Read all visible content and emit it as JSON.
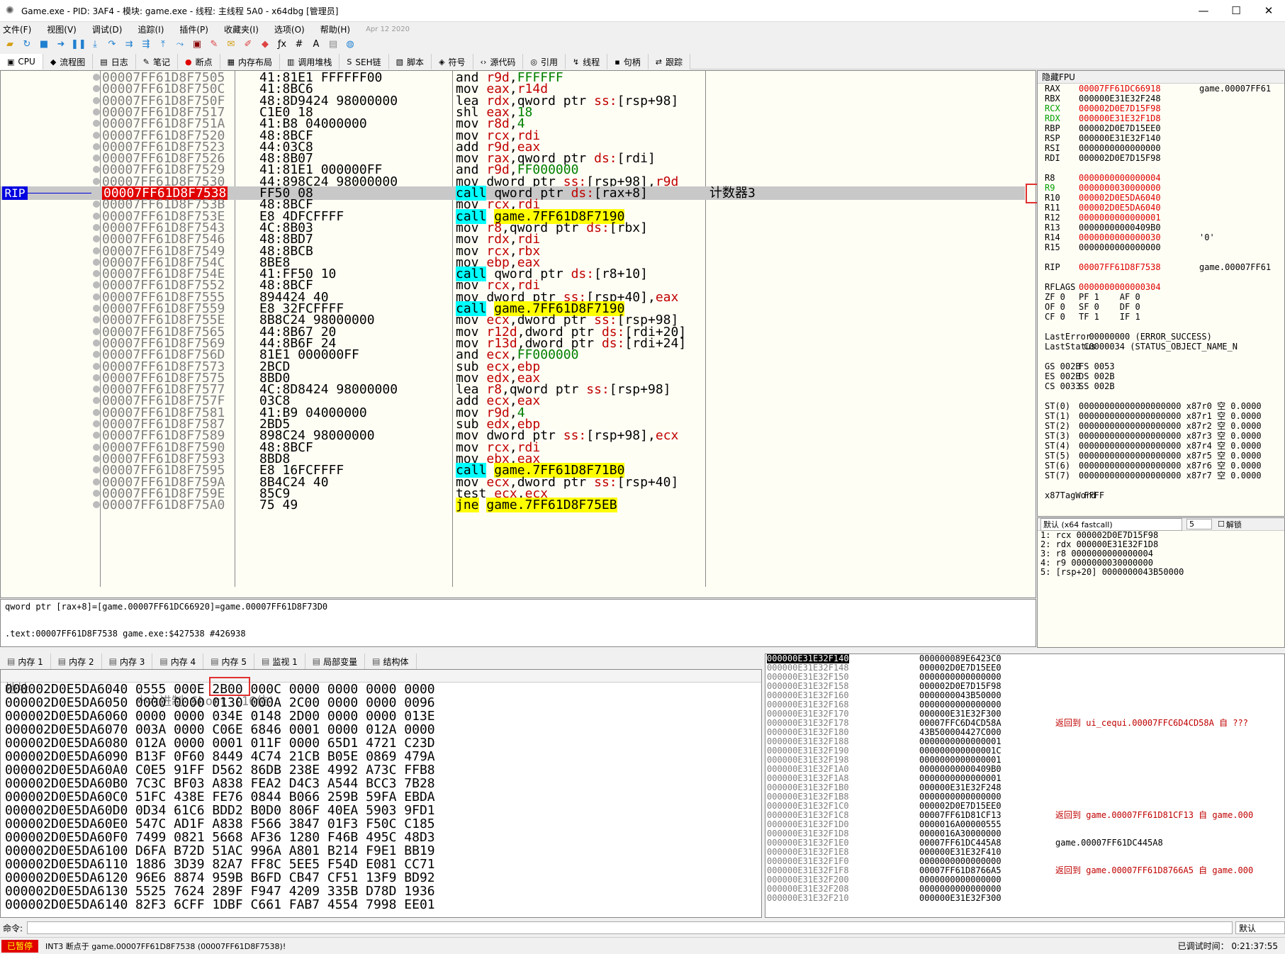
{
  "title": "Game.exe - PID: 3AF4 - 模块: game.exe - 线程: 主线程 5A0 - x64dbg [管理员]",
  "menu": [
    "文件(F)",
    "视图(V)",
    "调试(D)",
    "追踪(I)",
    "插件(P)",
    "收藏夹(I)",
    "选项(O)",
    "帮助(H)",
    "Apr 12 2020"
  ],
  "tabs": [
    "CPU",
    "流程图",
    "日志",
    "笔记",
    "断点",
    "内存布局",
    "调用堆栈",
    "SEH链",
    "脚本",
    "符号",
    "源代码",
    "引用",
    "线程",
    "句柄",
    "跟踪"
  ],
  "rip_label": "RIP",
  "cpu_rows": [
    {
      "addr": "00007FF61D8F7505",
      "bytes": "41:81E1 FFFFFF00",
      "dis": "and r9d,FFFFFF"
    },
    {
      "addr": "00007FF61D8F750C",
      "bytes": "41:8BC6",
      "dis": "mov eax,r14d"
    },
    {
      "addr": "00007FF61D8F750F",
      "bytes": "48:8D9424 98000000",
      "dis": "lea rdx,qword ptr ss:[rsp+98]"
    },
    {
      "addr": "00007FF61D8F7517",
      "bytes": "C1E0 18",
      "dis": "shl eax,18"
    },
    {
      "addr": "00007FF61D8F751A",
      "bytes": "41:B8 04000000",
      "dis": "mov r8d,4"
    },
    {
      "addr": "00007FF61D8F7520",
      "bytes": "48:8BCF",
      "dis": "mov rcx,rdi"
    },
    {
      "addr": "00007FF61D8F7523",
      "bytes": "44:03C8",
      "dis": "add r9d,eax"
    },
    {
      "addr": "00007FF61D8F7526",
      "bytes": "48:8B07",
      "dis": "mov rax,qword ptr ds:[rdi]"
    },
    {
      "addr": "00007FF61D8F7529",
      "bytes": "41:81E1 000000FF",
      "dis": "and r9d,FF000000"
    },
    {
      "addr": "00007FF61D8F7530",
      "bytes": "44:898C24 98000000",
      "dis": "mov dword ptr ss:[rsp+98],r9d"
    },
    {
      "addr": "00007FF61D8F7538",
      "bytes": "FF50 08",
      "dis": "call qword ptr ds:[rax+8]",
      "cmt": "计数器3",
      "cur": true
    },
    {
      "addr": "00007FF61D8F753B",
      "bytes": "48:8BCF",
      "dis": "mov rcx,rdi"
    },
    {
      "addr": "00007FF61D8F753E",
      "bytes": "E8 4DFCFFFF",
      "dis": "call game.7FF61D8F7190"
    },
    {
      "addr": "00007FF61D8F7543",
      "bytes": "4C:8B03",
      "dis": "mov r8,qword ptr ds:[rbx]"
    },
    {
      "addr": "00007FF61D8F7546",
      "bytes": "48:8BD7",
      "dis": "mov rdx,rdi"
    },
    {
      "addr": "00007FF61D8F7549",
      "bytes": "48:8BCB",
      "dis": "mov rcx,rbx"
    },
    {
      "addr": "00007FF61D8F754C",
      "bytes": "8BE8",
      "dis": "mov ebp,eax"
    },
    {
      "addr": "00007FF61D8F754E",
      "bytes": "41:FF50 10",
      "dis": "call qword ptr ds:[r8+10]"
    },
    {
      "addr": "00007FF61D8F7552",
      "bytes": "48:8BCF",
      "dis": "mov rcx,rdi"
    },
    {
      "addr": "00007FF61D8F7555",
      "bytes": "894424 40",
      "dis": "mov dword ptr ss:[rsp+40],eax"
    },
    {
      "addr": "00007FF61D8F7559",
      "bytes": "E8 32FCFFFF",
      "dis": "call game.7FF61D8F7190"
    },
    {
      "addr": "00007FF61D8F755E",
      "bytes": "8B8C24 98000000",
      "dis": "mov ecx,dword ptr ss:[rsp+98]"
    },
    {
      "addr": "00007FF61D8F7565",
      "bytes": "44:8B67 20",
      "dis": "mov r12d,dword ptr ds:[rdi+20]"
    },
    {
      "addr": "00007FF61D8F7569",
      "bytes": "44:8B6F 24",
      "dis": "mov r13d,dword ptr ds:[rdi+24]"
    },
    {
      "addr": "00007FF61D8F756D",
      "bytes": "81E1 000000FF",
      "dis": "and ecx,FF000000"
    },
    {
      "addr": "00007FF61D8F7573",
      "bytes": "2BCD",
      "dis": "sub ecx,ebp"
    },
    {
      "addr": "00007FF61D8F7575",
      "bytes": "8BD0",
      "dis": "mov edx,eax"
    },
    {
      "addr": "00007FF61D8F7577",
      "bytes": "4C:8D8424 98000000",
      "dis": "lea r8,qword ptr ss:[rsp+98]"
    },
    {
      "addr": "00007FF61D8F757F",
      "bytes": "03C8",
      "dis": "add ecx,eax"
    },
    {
      "addr": "00007FF61D8F7581",
      "bytes": "41:B9 04000000",
      "dis": "mov r9d,4"
    },
    {
      "addr": "00007FF61D8F7587",
      "bytes": "2BD5",
      "dis": "sub edx,ebp"
    },
    {
      "addr": "00007FF61D8F7589",
      "bytes": "898C24 98000000",
      "dis": "mov dword ptr ss:[rsp+98],ecx"
    },
    {
      "addr": "00007FF61D8F7590",
      "bytes": "48:8BCF",
      "dis": "mov rcx,rdi"
    },
    {
      "addr": "00007FF61D8F7593",
      "bytes": "8BD8",
      "dis": "mov ebx,eax"
    },
    {
      "addr": "00007FF61D8F7595",
      "bytes": "E8 16FCFFFF",
      "dis": "call game.7FF61D8F71B0"
    },
    {
      "addr": "00007FF61D8F759A",
      "bytes": "8B4C24 40",
      "dis": "mov ecx,dword ptr ss:[rsp+40]"
    },
    {
      "addr": "00007FF61D8F759E",
      "bytes": "85C9",
      "dis": "test ecx,ecx"
    },
    {
      "addr": "00007FF61D8F75A0",
      "bytes": "75 49",
      "dis": "jne game.7FF61D8F75EB"
    }
  ],
  "reg_header": "隐藏FPU",
  "registers": [
    {
      "n": "RAX",
      "v": "00007FF61DC66918",
      "c": "game.00007FF61",
      "col": "red"
    },
    {
      "n": "RBX",
      "v": "000000E31E32F248",
      "c": ""
    },
    {
      "n": "RCX",
      "v": "000002D0E7D15F98",
      "c": "",
      "col": "red",
      "ncol": "green"
    },
    {
      "n": "RDX",
      "v": "000000E31E32F1D8",
      "c": "",
      "col": "red",
      "ncol": "green"
    },
    {
      "n": "RBP",
      "v": "000002D0E7D15EE0",
      "c": ""
    },
    {
      "n": "RSP",
      "v": "000000E31E32F140",
      "c": ""
    },
    {
      "n": "RSI",
      "v": "0000000000000000",
      "c": ""
    },
    {
      "n": "RDI",
      "v": "000002D0E7D15F98",
      "c": ""
    },
    {
      "n": "",
      "v": "",
      "c": ""
    },
    {
      "n": "R8",
      "v": "0000000000000004",
      "c": "",
      "col": "red"
    },
    {
      "n": "R9",
      "v": "0000000030000000",
      "c": "",
      "col": "red",
      "ncol": "green"
    },
    {
      "n": "R10",
      "v": "000002D0E5DA6040",
      "c": "",
      "col": "red"
    },
    {
      "n": "R11",
      "v": "000002D0E5DA6040",
      "c": "",
      "col": "red"
    },
    {
      "n": "R12",
      "v": "0000000000000001",
      "c": "",
      "col": "red"
    },
    {
      "n": "R13",
      "v": "00000000000409B0",
      "c": ""
    },
    {
      "n": "R14",
      "v": "0000000000000030",
      "c": "'0'",
      "col": "red"
    },
    {
      "n": "R15",
      "v": "0000000000000000",
      "c": ""
    },
    {
      "n": "",
      "v": "",
      "c": ""
    },
    {
      "n": "RIP",
      "v": "00007FF61D8F7538",
      "c": "game.00007FF61",
      "col": "red"
    },
    {
      "n": "",
      "v": "",
      "c": ""
    },
    {
      "n": "RFLAGS",
      "v": "0000000000000304",
      "c": "",
      "col": "red"
    },
    {
      "n": "ZF 0",
      "v": "PF 1    AF 0",
      "c": ""
    },
    {
      "n": "OF 0",
      "v": "SF 0    DF 0",
      "c": ""
    },
    {
      "n": "CF 0",
      "v": "TF 1    IF 1",
      "c": ""
    },
    {
      "n": "",
      "v": "",
      "c": ""
    },
    {
      "n": "LastError",
      "v": "  00000000 (ERROR_SUCCESS)",
      "c": ""
    },
    {
      "n": "LastStatus",
      "v": " C0000034 (STATUS_OBJECT_NAME_N",
      "c": ""
    },
    {
      "n": "",
      "v": "",
      "c": ""
    },
    {
      "n": "GS 002B",
      "v": "FS 0053",
      "c": ""
    },
    {
      "n": "ES 002B",
      "v": "DS 002B",
      "c": ""
    },
    {
      "n": "CS 0033",
      "v": "SS 002B",
      "c": ""
    },
    {
      "n": "",
      "v": "",
      "c": ""
    },
    {
      "n": "ST(0)",
      "v": "00000000000000000000 x87r0 空 0.0000",
      "c": ""
    },
    {
      "n": "ST(1)",
      "v": "00000000000000000000 x87r1 空 0.0000",
      "c": ""
    },
    {
      "n": "ST(2)",
      "v": "00000000000000000000 x87r2 空 0.0000",
      "c": ""
    },
    {
      "n": "ST(3)",
      "v": "00000000000000000000 x87r3 空 0.0000",
      "c": ""
    },
    {
      "n": "ST(4)",
      "v": "00000000000000000000 x87r4 空 0.0000",
      "c": ""
    },
    {
      "n": "ST(5)",
      "v": "00000000000000000000 x87r5 空 0.0000",
      "c": ""
    },
    {
      "n": "ST(6)",
      "v": "00000000000000000000 x87r6 空 0.0000",
      "c": ""
    },
    {
      "n": "ST(7)",
      "v": "00000000000000000000 x87r7 空 0.0000",
      "c": ""
    },
    {
      "n": "",
      "v": "",
      "c": ""
    },
    {
      "n": "x87TagWord",
      "v": " FFFF",
      "c": ""
    }
  ],
  "callconv": {
    "label": "默认 (x64 fastcall)",
    "count": "5",
    "unlock": "解锁",
    "args": [
      "1: rcx 000002D0E7D15F98",
      "2: rdx 000000E31E32F1D8",
      "3: r8 0000000000000004",
      "4: r9 0000000030000000",
      "5: [rsp+20] 0000000043B50000"
    ]
  },
  "info": {
    "line1": "qword ptr [rax+8]=[game.00007FF61DC66920]=game.00007FF61D8F73D0",
    "line2": ".text:00007FF61D8F7538 game.exe:$427538 #426938"
  },
  "dump_tabs": [
    "内存 1",
    "内存 2",
    "内存 3",
    "内存 4",
    "内存 5",
    "监视 1",
    "局部变量",
    "结构体"
  ],
  "dump_header": {
    "addr": "地址",
    "hex": "十六进制 Short (16位)"
  },
  "dump_rows": [
    {
      "a": "000002D0E5DA6040",
      "v": "0555 000E 2B00 000C 0000 0000 0000 0000"
    },
    {
      "a": "000002D0E5DA6050",
      "v": "0000 0000 0130 000A 2C00 0000 0000 0096"
    },
    {
      "a": "000002D0E5DA6060",
      "v": "0000 0000 034E 0148 2D00 0000 0000 013E"
    },
    {
      "a": "000002D0E5DA6070",
      "v": "003A 0000 C06E 6846 0001 0000 012A 0000"
    },
    {
      "a": "000002D0E5DA6080",
      "v": "012A 0000 0001 011F 0000 65D1 4721 C23D"
    },
    {
      "a": "000002D0E5DA6090",
      "v": "B13F 0F60 8449 4C74 21CB B05E 0869 479A"
    },
    {
      "a": "000002D0E5DA60A0",
      "v": "C0E5 91FF D562 86DB 238E 4992 A73C FFB8"
    },
    {
      "a": "000002D0E5DA60B0",
      "v": "7C3C BF03 A838 FEA2 D4C3 A544 BCC3 7B28"
    },
    {
      "a": "000002D0E5DA60C0",
      "v": "51FC 438E FE76 0844 B066 259B 59FA EBDA"
    },
    {
      "a": "000002D0E5DA60D0",
      "v": "0D34 61C6 BDD2 B0D0 806F 40EA 5903 9FD1"
    },
    {
      "a": "000002D0E5DA60E0",
      "v": "547C AD1F A838 F566 3847 01F3 F50C C185"
    },
    {
      "a": "000002D0E5DA60F0",
      "v": "7499 0821 5668 AF36 1280 F46B 495C 48D3"
    },
    {
      "a": "000002D0E5DA6100",
      "v": "D6FA B72D 51AC 996A A801 B214 F9E1 BB19"
    },
    {
      "a": "000002D0E5DA6110",
      "v": "1886 3D39 82A7 FF8C 5EE5 F54D E081 CC71"
    },
    {
      "a": "000002D0E5DA6120",
      "v": "96E6 8874 959B B6FD CB47 CF51 13F9 BD92"
    },
    {
      "a": "000002D0E5DA6130",
      "v": "5525 7624 289F F947 4209 335B D78D 1936"
    },
    {
      "a": "000002D0E5DA6140",
      "v": "82F3 6CFF 1DBF C661 FAB7 4554 7998 EE01"
    }
  ],
  "stack_rows": [
    {
      "a": "000000E31E32F140",
      "v": "000000089E6423C0",
      "c": ""
    },
    {
      "a": "000000E31E32F148",
      "v": "000002D0E7D15EE0",
      "c": ""
    },
    {
      "a": "000000E31E32F150",
      "v": "0000000000000000",
      "c": ""
    },
    {
      "a": "000000E31E32F158",
      "v": "000002D0E7D15F98",
      "c": ""
    },
    {
      "a": "000000E31E32F160",
      "v": "0000000043B50000",
      "c": ""
    },
    {
      "a": "000000E31E32F168",
      "v": "0000000000000000",
      "c": ""
    },
    {
      "a": "000000E31E32F170",
      "v": "000000E31E32F300",
      "c": ""
    },
    {
      "a": "000000E31E32F178",
      "v": "00007FFC6D4CD58A",
      "c": "返回到 ui_cequi.00007FFC6D4CD58A 自 ???"
    },
    {
      "a": "000000E31E32F180",
      "v": "43B500004427C000",
      "c": ""
    },
    {
      "a": "000000E31E32F188",
      "v": "0000000000000001",
      "c": ""
    },
    {
      "a": "000000E31E32F190",
      "v": "000000000000001C",
      "c": ""
    },
    {
      "a": "000000E31E32F198",
      "v": "0000000000000001",
      "c": ""
    },
    {
      "a": "000000E31E32F1A0",
      "v": "00000000000409B0",
      "c": ""
    },
    {
      "a": "000000E31E32F1A8",
      "v": "0000000000000001",
      "c": ""
    },
    {
      "a": "000000E31E32F1B0",
      "v": "000000E31E32F248",
      "c": ""
    },
    {
      "a": "000000E31E32F1B8",
      "v": "0000000000000000",
      "c": ""
    },
    {
      "a": "000000E31E32F1C0",
      "v": "000002D0E7D15EE0",
      "c": ""
    },
    {
      "a": "000000E31E32F1C8",
      "v": "00007FF61D81CF13",
      "c": "返回到 game.00007FF61D81CF13 自 game.000"
    },
    {
      "a": "000000E31E32F1D0",
      "v": "0000016A00000555",
      "c": ""
    },
    {
      "a": "000000E31E32F1D8",
      "v": "0000016A30000000",
      "c": ""
    },
    {
      "a": "000000E31E32F1E0",
      "v": "00007FF61DC445A8",
      "c": "game.00007FF61DC445A8"
    },
    {
      "a": "000000E31E32F1E8",
      "v": "000000E31E32F410",
      "c": ""
    },
    {
      "a": "000000E31E32F1F0",
      "v": "0000000000000000",
      "c": ""
    },
    {
      "a": "000000E31E32F1F8",
      "v": "00007FF61D8766A5",
      "c": "返回到 game.00007FF61D8766A5 自 game.000"
    },
    {
      "a": "000000E31E32F200",
      "v": "0000000000000000",
      "c": ""
    },
    {
      "a": "000000E31E32F208",
      "v": "0000000000000000",
      "c": ""
    },
    {
      "a": "000000E31E32F210",
      "v": "000000E31E32F300",
      "c": ""
    }
  ],
  "cmd_label": "命令:",
  "cmd_default": "默认",
  "status": {
    "state": "已暂停",
    "msg": "INT3 断点于 game.00007FF61D8F7538 (00007FF61D8F7538)!",
    "time": "已调试时间： 0:21:37:55"
  }
}
